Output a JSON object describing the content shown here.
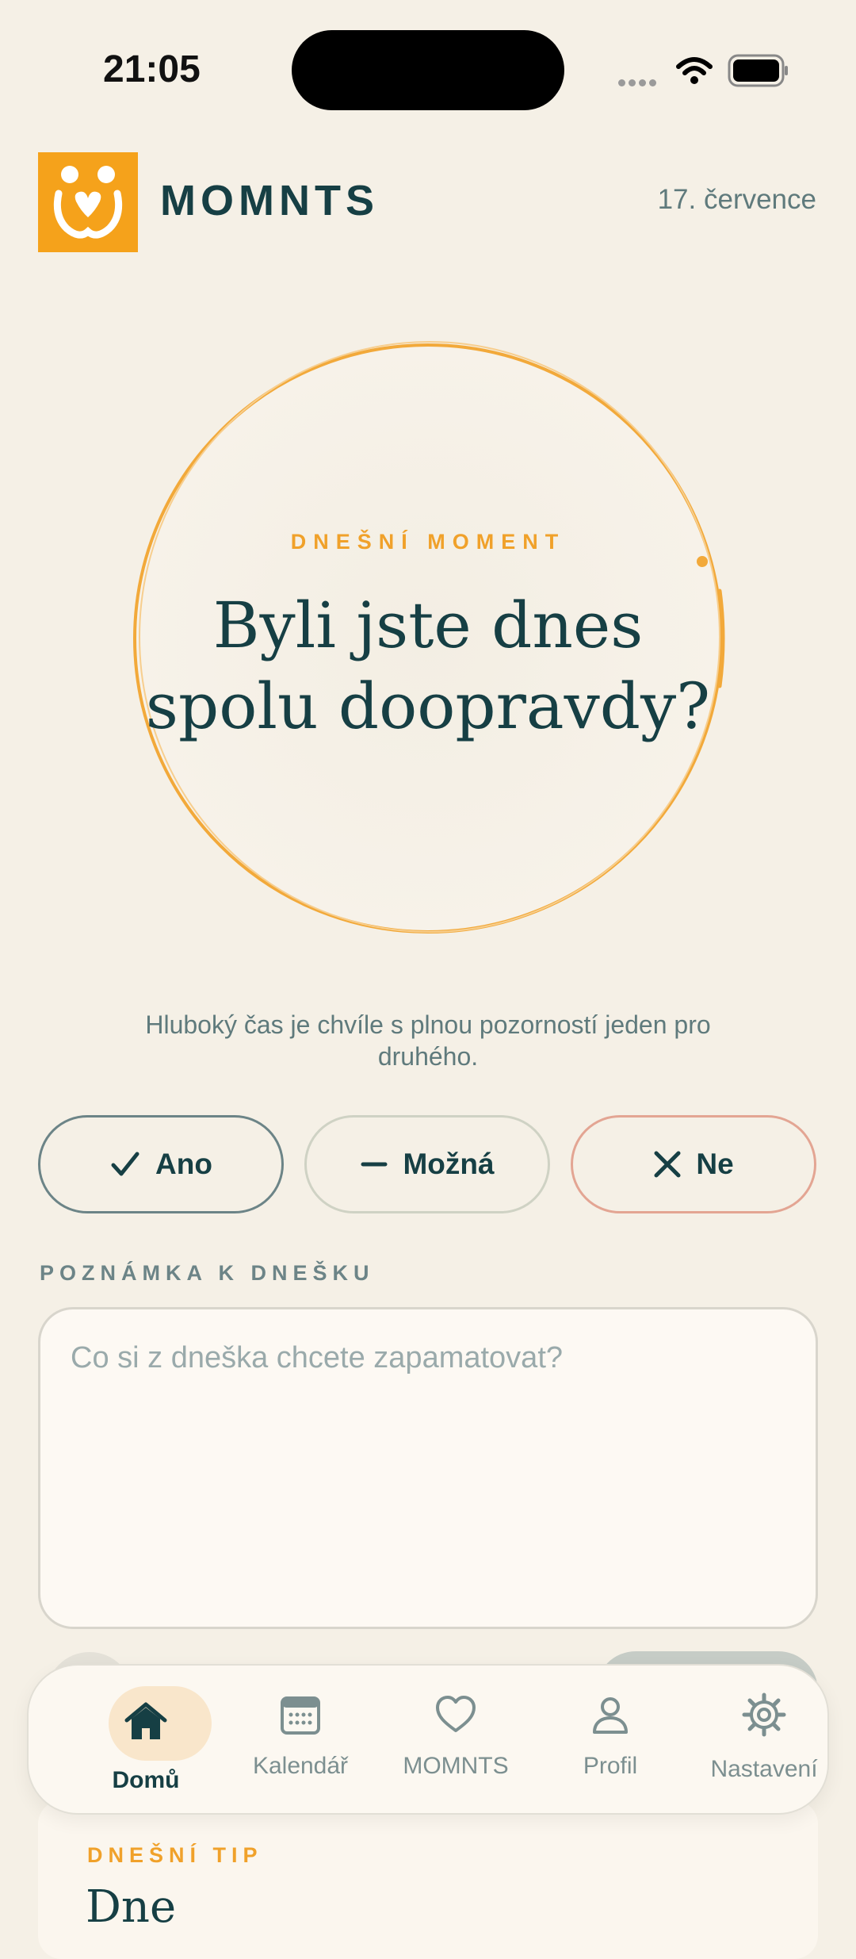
{
  "status_bar": {
    "time": "21:05"
  },
  "header": {
    "brand": "MOMNTS",
    "date": "17. července",
    "logo_icon": "family-heart-logo"
  },
  "moment": {
    "eyebrow": "DNEŠNÍ MOMENT",
    "question_line1": "Byli jste dnes",
    "question_line2": "spolu doopravdy?",
    "description": "Hluboký čas je chvíle s plnou pozorností jeden pro druhého."
  },
  "answers": {
    "yes": "Ano",
    "maybe": "Možná",
    "no": "Ne"
  },
  "note": {
    "label": "POZNÁMKA K DNEŠKU",
    "placeholder": "Co si z dneška chcete zapamatovat?"
  },
  "tip": {
    "label": "DNEŠNÍ TIP",
    "title": "Dne"
  },
  "nav": {
    "items": [
      {
        "label": "Domů",
        "icon": "home-icon"
      },
      {
        "label": "Kalendář",
        "icon": "calendar-icon"
      },
      {
        "label": "MOMNTS",
        "icon": "heart-icon"
      },
      {
        "label": "Profil",
        "icon": "person-icon"
      },
      {
        "label": "Nastavení",
        "icon": "gear-icon"
      }
    ]
  },
  "colors": {
    "accent": "#F5A21B",
    "ink": "#163F44",
    "muted": "#5F7A7C",
    "background": "#F5F0E6"
  }
}
